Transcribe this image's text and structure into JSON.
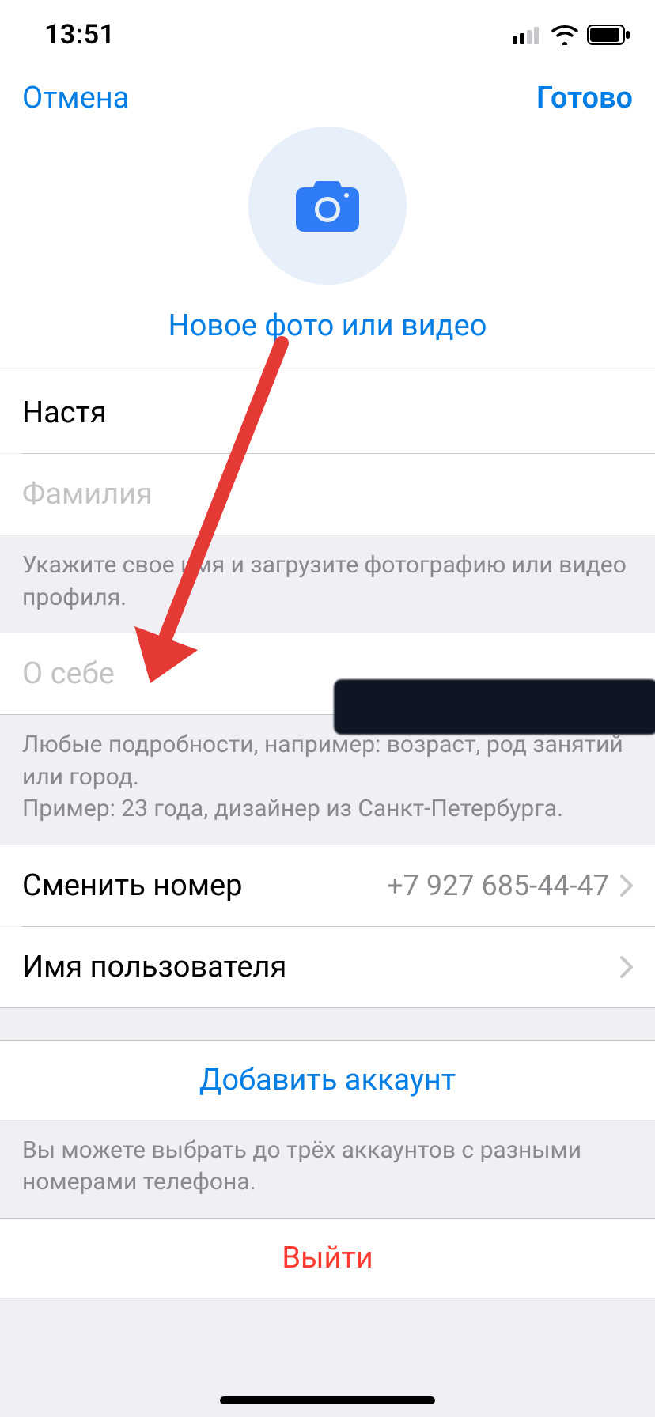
{
  "status": {
    "time": "13:51"
  },
  "header": {
    "cancel": "Отмена",
    "done": "Готово",
    "new_photo": "Новое фото или видео"
  },
  "fields": {
    "first_name_value": "Настя",
    "last_name_placeholder": "Фамилия",
    "bio_placeholder": "О себе"
  },
  "hints": {
    "name": "Укажите свое имя и загрузите фотографию или видео профиля.",
    "bio_line1": "Любые подробности, например: возраст, род занятий или город.",
    "bio_line2": "Пример: 23 года, дизайнер из Санкт-Петербурга."
  },
  "rows": {
    "change_number": "Сменить номер",
    "change_number_value": "+7 927 685-44-47",
    "username": "Имя пользователя",
    "add_account": "Добавить аккаунт",
    "logout": "Выйти"
  },
  "hints2": {
    "accounts": "Вы можете выбрать до трёх аккаунтов с разными номерами телефона."
  },
  "colors": {
    "accent": "#037EE5",
    "destructive": "#FF3B30",
    "hint": "#8A8A8E",
    "placeholder": "#C4C4C6",
    "separator": "#C7C7CC",
    "group_bg": "#EFEFF4"
  }
}
